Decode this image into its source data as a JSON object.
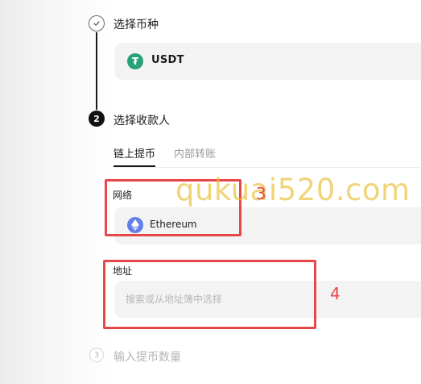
{
  "steps": {
    "step1": {
      "title": "选择币种",
      "coin": {
        "icon": "tether-icon",
        "label": "USDT",
        "icon_color": "#27a17a"
      }
    },
    "step2": {
      "number": "2",
      "title": "选择收款人",
      "tabs": [
        {
          "label": "链上提币",
          "active": true
        },
        {
          "label": "内部转账",
          "active": false
        }
      ],
      "network": {
        "label": "网络",
        "value": "Ethereum",
        "icon": "ethereum-icon",
        "icon_color": "#627eea"
      },
      "address": {
        "label": "地址",
        "placeholder": "搜索或从地址簿中选择",
        "value": ""
      }
    },
    "step3": {
      "number": "3",
      "title": "输入提币数量"
    }
  },
  "annotations": {
    "box3_label": "3",
    "box4_label": "4",
    "color": "#e8474a"
  },
  "watermark": {
    "text": "qukuai520.com"
  }
}
